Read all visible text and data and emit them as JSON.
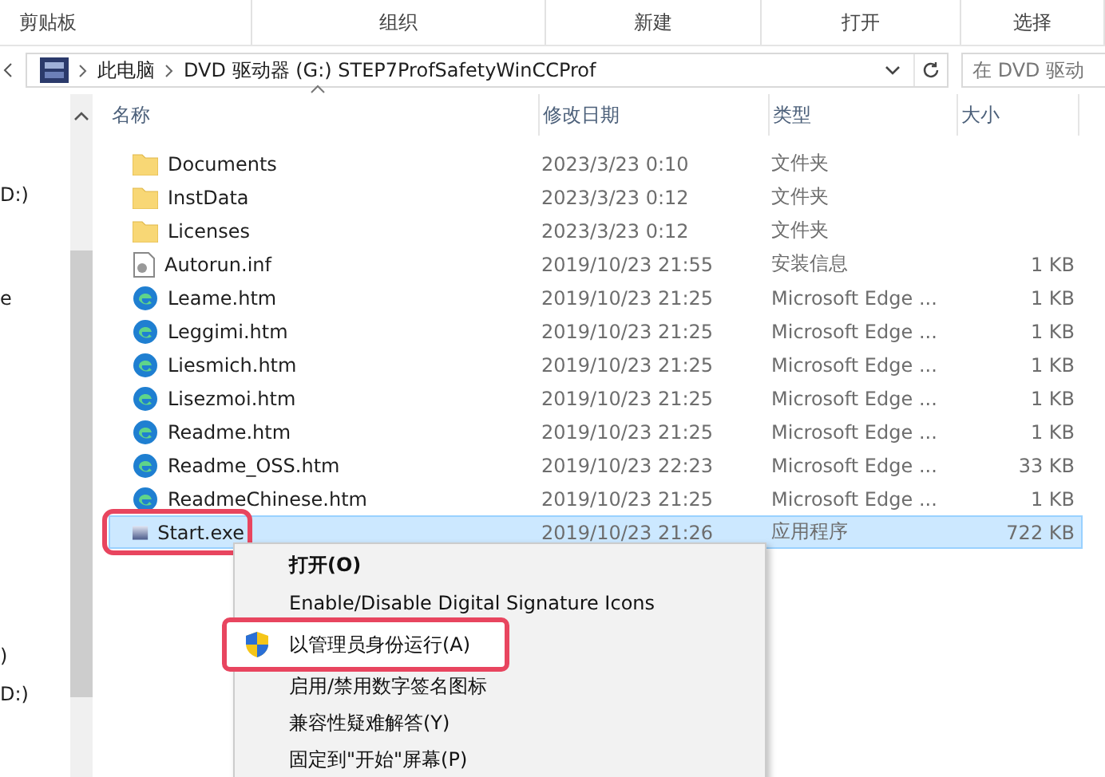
{
  "ribbon": {
    "groups": [
      "剪贴板",
      "组织",
      "新建",
      "打开",
      "选择"
    ]
  },
  "address_bar": {
    "path": [
      "此电脑",
      "DVD 驱动器 (G:) STEP7ProfSafetyWinCCProf"
    ]
  },
  "search": {
    "placeholder": "在 DVD 驱动"
  },
  "nav_pane": {
    "items": [
      "D:)",
      "e",
      ")",
      "D:)"
    ]
  },
  "table": {
    "columns": [
      "名称",
      "修改日期",
      "类型",
      "大小"
    ],
    "rows": [
      {
        "kind": "folder",
        "name": "Documents",
        "modified": "2023/3/23 0:10",
        "type": "文件夹",
        "size": "",
        "selected": false,
        "marked": false
      },
      {
        "kind": "folder",
        "name": "InstData",
        "modified": "2023/3/23 0:12",
        "type": "文件夹",
        "size": "",
        "selected": false,
        "marked": false
      },
      {
        "kind": "folder",
        "name": "Licenses",
        "modified": "2023/3/23 0:12",
        "type": "文件夹",
        "size": "",
        "selected": false,
        "marked": false
      },
      {
        "kind": "setup",
        "name": "Autorun.inf",
        "modified": "2019/10/23 21:55",
        "type": "安装信息",
        "size": "1 KB",
        "selected": false,
        "marked": false
      },
      {
        "kind": "web",
        "name": "Leame.htm",
        "modified": "2019/10/23 21:25",
        "type": "Microsoft Edge ...",
        "size": "1 KB",
        "selected": false,
        "marked": false
      },
      {
        "kind": "web",
        "name": "Leggimi.htm",
        "modified": "2019/10/23 21:25",
        "type": "Microsoft Edge ...",
        "size": "1 KB",
        "selected": false,
        "marked": false
      },
      {
        "kind": "web",
        "name": "Liesmich.htm",
        "modified": "2019/10/23 21:25",
        "type": "Microsoft Edge ...",
        "size": "1 KB",
        "selected": false,
        "marked": false
      },
      {
        "kind": "web",
        "name": "Lisezmoi.htm",
        "modified": "2019/10/23 21:25",
        "type": "Microsoft Edge ...",
        "size": "1 KB",
        "selected": false,
        "marked": false
      },
      {
        "kind": "web",
        "name": "Readme.htm",
        "modified": "2019/10/23 21:25",
        "type": "Microsoft Edge ...",
        "size": "1 KB",
        "selected": false,
        "marked": false
      },
      {
        "kind": "web",
        "name": "Readme_OSS.htm",
        "modified": "2019/10/23 22:23",
        "type": "Microsoft Edge ...",
        "size": "33 KB",
        "selected": false,
        "marked": false
      },
      {
        "kind": "web",
        "name": "ReadmeChinese.htm",
        "modified": "2019/10/23 21:25",
        "type": "Microsoft Edge ...",
        "size": "1 KB",
        "selected": false,
        "marked": false
      },
      {
        "kind": "app",
        "name": "Start.exe",
        "modified": "2019/10/23 21:26",
        "type": "应用程序",
        "size": "722 KB",
        "selected": true,
        "marked": true
      }
    ]
  },
  "context_menu": {
    "items": [
      {
        "label": "打开(O)",
        "bold": true,
        "shield": false,
        "marked": false
      },
      {
        "label": "Enable/Disable Digital Signature Icons",
        "bold": false,
        "shield": false,
        "marked": false
      },
      {
        "label": "以管理员身份运行(A)",
        "bold": false,
        "shield": true,
        "marked": true
      },
      {
        "label": "启用/禁用数字签名图标",
        "bold": false,
        "shield": false,
        "marked": false
      },
      {
        "label": "兼容性疑难解答(Y)",
        "bold": false,
        "shield": false,
        "marked": false
      },
      {
        "label": "固定到\"开始\"屏幕(P)",
        "bold": false,
        "shield": false,
        "marked": false
      }
    ]
  }
}
